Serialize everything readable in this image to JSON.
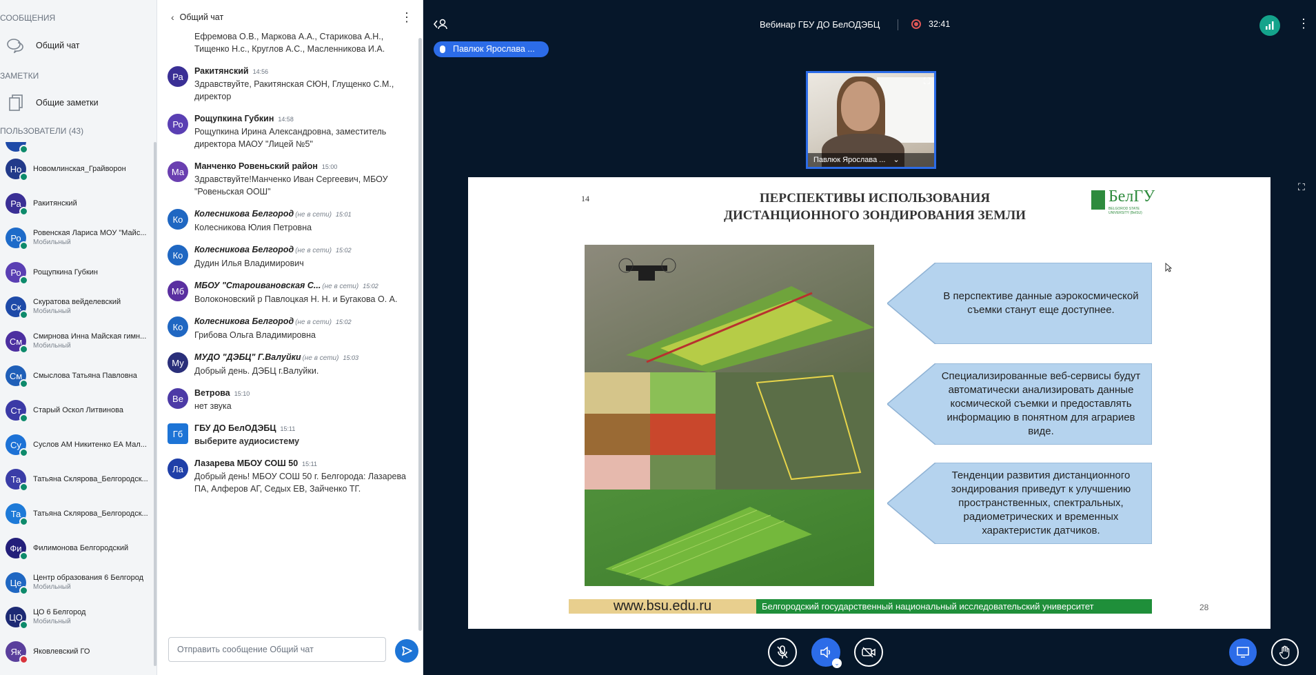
{
  "sidebar": {
    "messages_header": "СООБЩЕНИЯ",
    "general_chat": "Общий чат",
    "notes_header": "ЗАМЕТКИ",
    "shared_notes": "Общие заметки",
    "users_header": "ПОЛЬЗОВАТЕЛИ (43)",
    "users": [
      {
        "initials": "Но",
        "name": "Новомлинская_Грайворон",
        "sub": "",
        "color": "#223a8a"
      },
      {
        "initials": "Ра",
        "name": "Ракитянский",
        "sub": "",
        "color": "#3a2f95"
      },
      {
        "initials": "Ро",
        "name": "Ровенская Лариса МОУ \"Майс...",
        "sub": "Мобильный",
        "color": "#1e6bc9"
      },
      {
        "initials": "Ро",
        "name": "Рощупкина Губкин",
        "sub": "",
        "color": "#5a3fb3"
      },
      {
        "initials": "Ск",
        "name": "Скуратова вейделевский",
        "sub": "Мобильный",
        "color": "#1e4aa8"
      },
      {
        "initials": "См",
        "name": "Смирнова Инна Майская гимн...",
        "sub": "Мобильный",
        "color": "#4c2fa0"
      },
      {
        "initials": "См",
        "name": "Смыслова Татьяна Павловна",
        "sub": "",
        "color": "#1f5fb8"
      },
      {
        "initials": "Ст",
        "name": "Старый Оскол Литвинова",
        "sub": "",
        "color": "#3b3aa6"
      },
      {
        "initials": "Су",
        "name": "Суслов АМ Никитенко ЕА Мал...",
        "sub": "",
        "color": "#1d72d6"
      },
      {
        "initials": "Та",
        "name": "Татьяна Склярова_Белгородск...",
        "sub": "",
        "color": "#3a3da7"
      },
      {
        "initials": "Та",
        "name": "Татьяна Склярова_Белгородск...",
        "sub": "",
        "color": "#1d7ad8"
      },
      {
        "initials": "Фи",
        "name": "Филимонова Белгородский",
        "sub": "",
        "color": "#231f7a"
      },
      {
        "initials": "Це",
        "name": "Центр образования 6 Белгород",
        "sub": "Мобильный",
        "color": "#1f67c2"
      },
      {
        "initials": "ЦО",
        "name": "ЦО 6 Белгород",
        "sub": "Мобильный",
        "color": "#1d2a74"
      },
      {
        "initials": "Як",
        "name": "Яковлевский ГО",
        "sub": "",
        "color": "#5a3f9c"
      }
    ]
  },
  "chat": {
    "title": "Общий чат",
    "input_placeholder": "Отправить сообщение Общий чат",
    "messages": [
      {
        "initials": "",
        "name": "",
        "time": "",
        "status": "",
        "text": "Ефремова О.В., Маркова А.А., Старикова А.Н., Тищенко Н.с., Круглов А.С., Масленникова И.А.",
        "color": ""
      },
      {
        "initials": "Ра",
        "name": "Ракитянский",
        "time": "14:56",
        "status": "",
        "text": "Здравствуйте, Ракитянская СЮН, Глущенко С.М., директор",
        "color": "#3a2f95"
      },
      {
        "initials": "Ро",
        "name": "Рощупкина Губкин",
        "time": "14:58",
        "status": "",
        "text": "Рощупкина Ирина Александровна, заместитель директора МАОУ \"Лицей №5\"",
        "color": "#5a3fb3"
      },
      {
        "initials": "Ма",
        "name": "Манченко Ровеньский район",
        "time": "15:00",
        "status": "",
        "text": "Здравствуйте!Манченко Иван Сергеевич, МБОУ \"Ровеньская ООШ\"",
        "color": "#6a3fb0"
      },
      {
        "initials": "Ко",
        "name": "Колесникова Белгород",
        "time": "15:01",
        "status": "(не в сети)",
        "text": "Колесникова Юлия Петровна",
        "color": "#1f67c2"
      },
      {
        "initials": "Ко",
        "name": "Колесникова Белгород",
        "time": "15:02",
        "status": "(не в сети)",
        "text": "Дудин Илья Владимирович",
        "color": "#1f67c2"
      },
      {
        "initials": "Мб",
        "name": "МБОУ \"Староивановская С...",
        "time": "15:02",
        "status": "(не в сети)",
        "text": "Волоконовский р Павлоцкая Н. Н. и Бугакова О. А.",
        "color": "#5a2fa0"
      },
      {
        "initials": "Ко",
        "name": "Колесникова Белгород",
        "time": "15:02",
        "status": "(не в сети)",
        "text": "Грибова Ольга Владимировна",
        "color": "#1f67c2"
      },
      {
        "initials": "Му",
        "name": "МУДО \"ДЭБЦ\" Г.Валуйки",
        "time": "15:03",
        "status": "(не в сети)",
        "text": "Добрый день. ДЭБЦ г.Валуйки.",
        "color": "#2a2f7a"
      },
      {
        "initials": "Ве",
        "name": "Ветрова",
        "time": "15:10",
        "status": "",
        "text": "нет звука",
        "color": "#4c3aa6"
      },
      {
        "initials": "Гб",
        "name": "ГБУ ДО БелОДЭБЦ",
        "time": "15:11",
        "status": "",
        "text": "выберите аудиосистему",
        "color": "#1d74d6"
      },
      {
        "initials": "Ла",
        "name": "Лазарева МБОУ СОШ 50",
        "time": "15:11",
        "status": "",
        "text": "Добрый день! МБОУ СОШ 50 г. Белгорода: Лазарева ПА, Алферов АГ, Седых ЕВ, Зайченко ТГ.",
        "color": "#1f3fa8"
      }
    ]
  },
  "meeting": {
    "title": "Вебинар ГБУ ДО БелОДЭБЦ",
    "timer": "32:41",
    "presenter": "Павлюк Ярослава ...",
    "webcam_label": "Павлюк Ярослава ..."
  },
  "slide": {
    "number": "14",
    "title_line1": "ПЕРСПЕКТИВЫ ИСПОЛЬЗОВАНИЯ",
    "title_line2": "ДИСТАНЦИОННОГО ЗОНДИРОВАНИЯ ЗЕМЛИ",
    "logo_big": "БелГУ",
    "logo_small_1": "BELGOROD STATE",
    "logo_small_2": "UNIVERSITY (BelSU)",
    "box1": "В перспективе данные аэрокосмической съемки станут еще доступнее.",
    "box2": "Специализированные веб-сервисы будут автоматически анализировать данные космической съемки и предоставлять информацию в понятном для аграриев виде.",
    "box3": "Тенденции развития дистанционного зондирования приведут к улучшению пространственных, спектральных, радиометрических и временных характеристик датчиков.",
    "url": "www.bsu.edu.ru",
    "university": "Белгородский государственный национальный исследовательский университет",
    "page": "28"
  },
  "colors": {
    "accent": "#2c6ce8",
    "dark_bg": "#06172a",
    "slide_green": "#1f8f3a",
    "box_blue": "#b5d3ee"
  }
}
